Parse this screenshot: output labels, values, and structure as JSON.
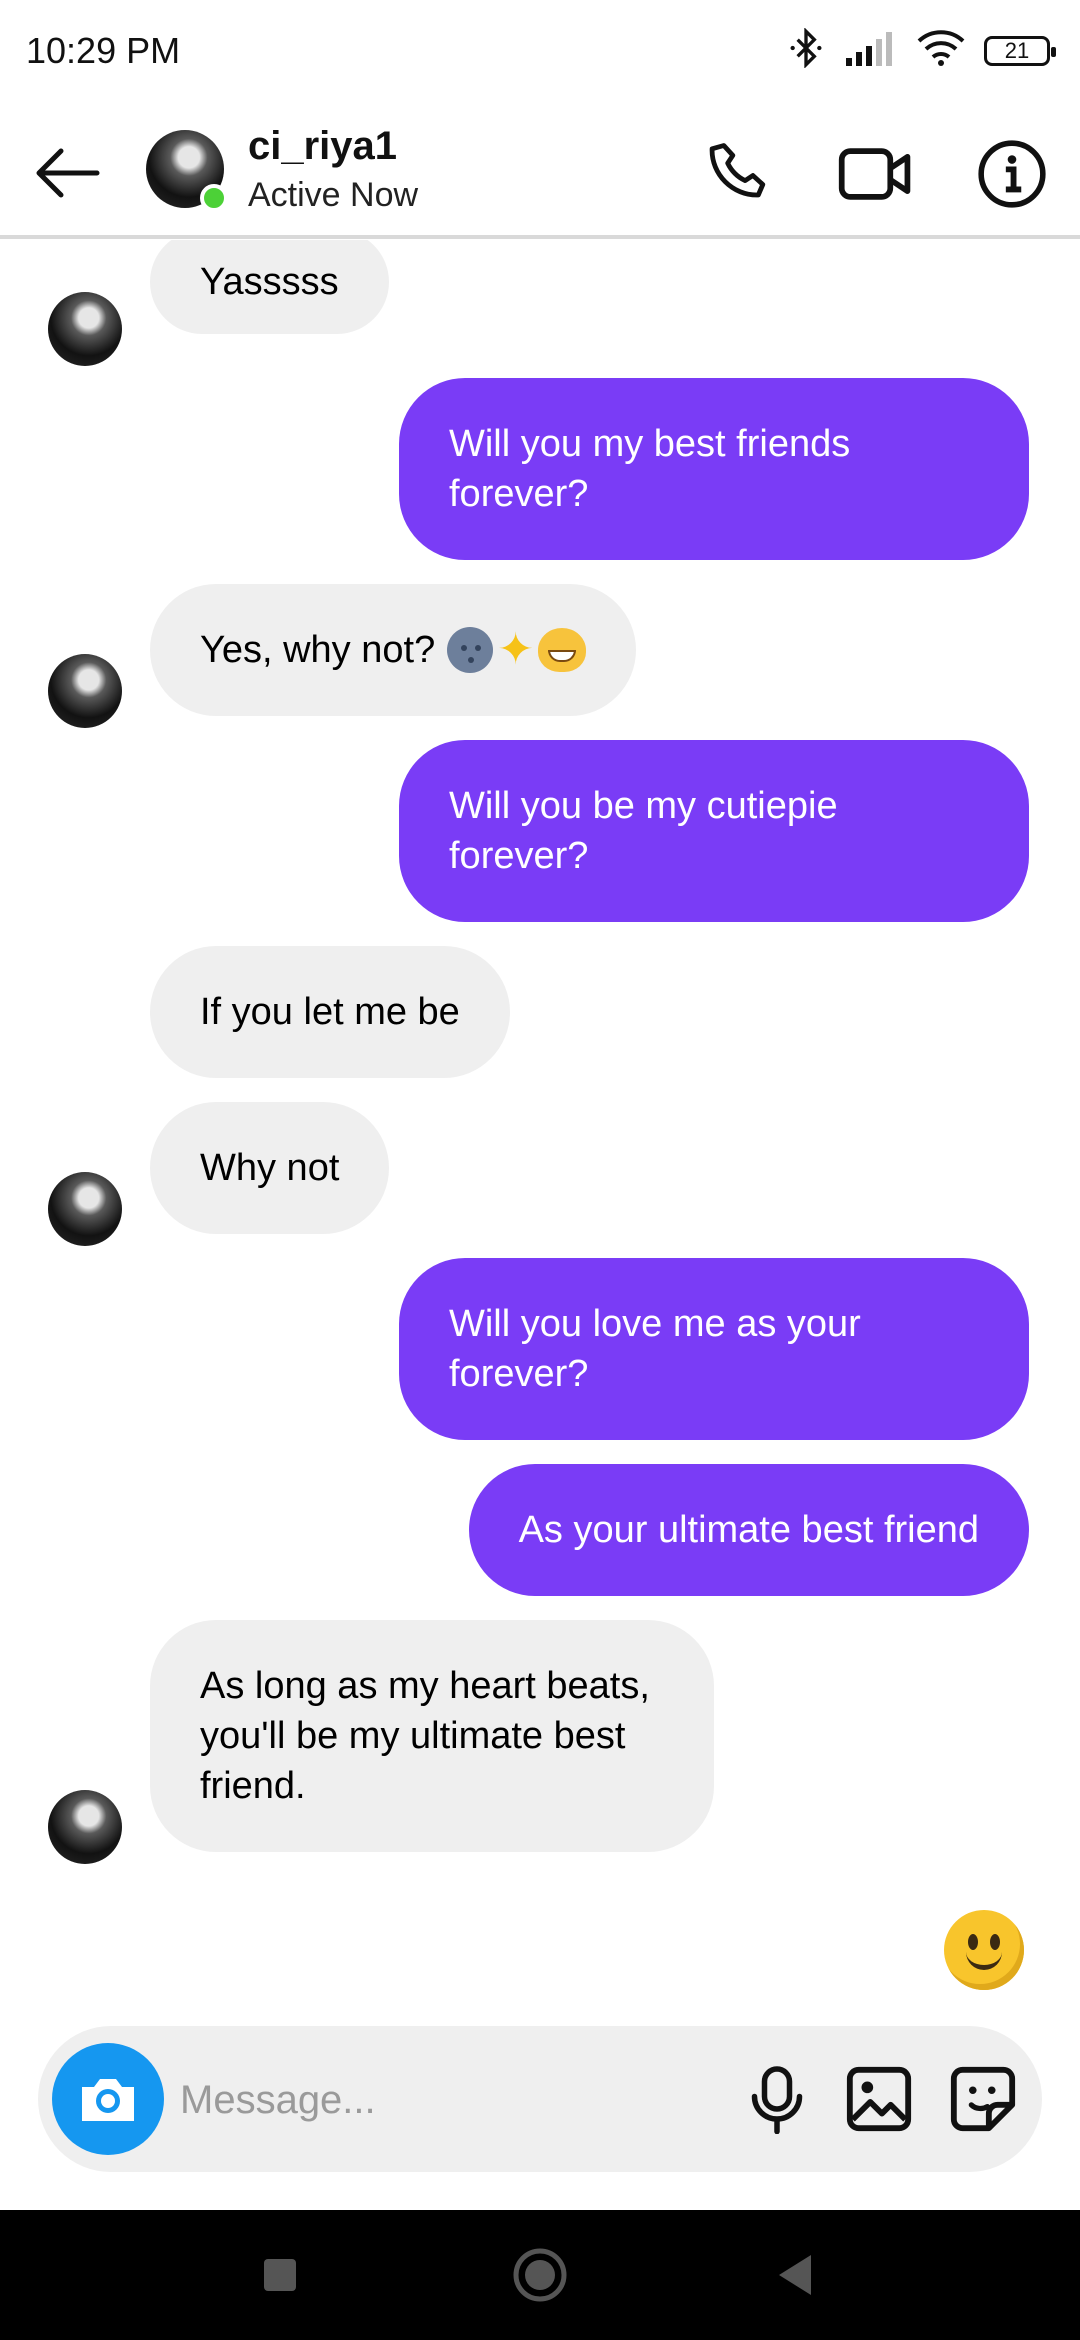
{
  "status_bar": {
    "time": "10:29 PM",
    "battery": "21"
  },
  "header": {
    "username": "ci_riya1",
    "status": "Active Now"
  },
  "messages": [
    {
      "from": "them",
      "text": "Yasssss"
    },
    {
      "from": "me",
      "text": "Will you my best friends forever?"
    },
    {
      "from": "them",
      "text": "Yes, why not?",
      "emojis": [
        "new-moon-face-emoji",
        "sparkles-emoji",
        "cat-tears-of-joy-emoji"
      ]
    },
    {
      "from": "me",
      "text": "Will you be my cutiepie forever?"
    },
    {
      "from": "them",
      "text": "If you let me be"
    },
    {
      "from": "them",
      "text": "Why not"
    },
    {
      "from": "me",
      "text": "Will you love me as your forever?"
    },
    {
      "from": "me",
      "text": "As your ultimate best friend"
    },
    {
      "from": "them",
      "text": "As long as my heart beats, you'll be my ultimate best friend."
    }
  ],
  "composer": {
    "placeholder": "Message..."
  },
  "colors": {
    "outgoing_bubble": "#7a3cf6",
    "incoming_bubble": "#efefef",
    "camera_button": "#1597f0",
    "online_dot": "#4cd137"
  }
}
